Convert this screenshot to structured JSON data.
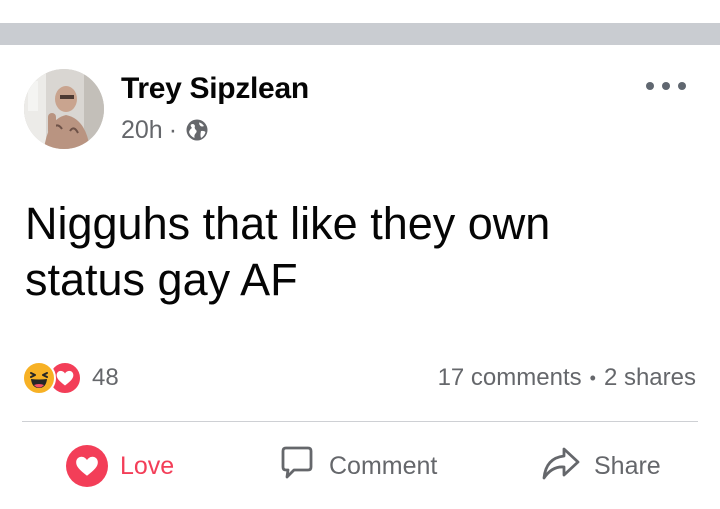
{
  "post": {
    "author_name": "Trey Sipzlean",
    "time": "20h",
    "separator": "·",
    "audience_icon": "globe-icon",
    "more_icon": "more-horizontal-icon",
    "text_line1": "Nigguhs that like they own",
    "text_line2": "status gay AF"
  },
  "engagement": {
    "reaction_icons": [
      "haha-icon",
      "love-icon"
    ],
    "reaction_count": "48",
    "comments": "17 comments",
    "bullet": "•",
    "shares": "2 shares"
  },
  "actions": {
    "love_label": "Love",
    "comment_label": "Comment",
    "share_label": "Share"
  },
  "colors": {
    "love": "#f33e58",
    "haha": "#f7b125",
    "secondary_text": "#65676b",
    "band": "#c9ccd1"
  }
}
